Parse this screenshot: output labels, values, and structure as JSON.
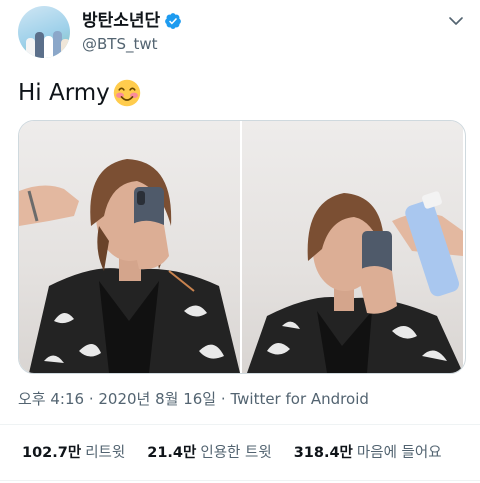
{
  "tweet": {
    "author": {
      "display_name": "방탄소년단",
      "handle": "@BTS_twt",
      "verified": true
    },
    "text": "Hi Army",
    "emoji": "smiling-face-with-rosy-cheeks",
    "timestamp": "오후 4:16 · 2020년 8월 16일",
    "separator": "·",
    "source": "Twitter for Android",
    "stats": [
      {
        "value": "102.7만",
        "label": "리트윗"
      },
      {
        "value": "21.4만",
        "label": "인용한 트윗"
      },
      {
        "value": "318.4만",
        "label": "마음에 들어요"
      }
    ]
  },
  "colors": {
    "verified": "#1d9bf0",
    "secondary_text": "#536471",
    "primary_text": "#0f1419"
  },
  "icons": {
    "more": "chevron-down-icon",
    "verified": "verified-badge-icon"
  }
}
